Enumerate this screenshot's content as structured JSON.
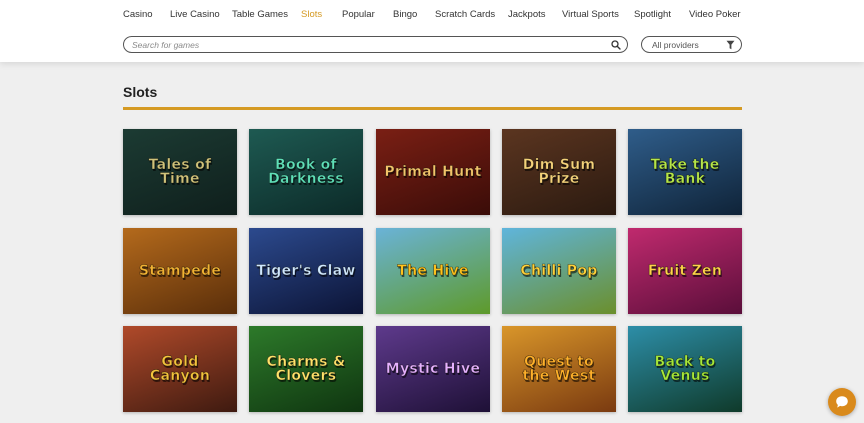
{
  "nav": {
    "items": [
      {
        "label": "Casino"
      },
      {
        "label": "Live Casino"
      },
      {
        "label": "Table Games"
      },
      {
        "label": "Slots",
        "active": true
      },
      {
        "label": "Popular"
      },
      {
        "label": "Bingo"
      },
      {
        "label": "Scratch Cards"
      },
      {
        "label": "Jackpots"
      },
      {
        "label": "Virtual Sports"
      },
      {
        "label": "Spotlight"
      },
      {
        "label": "Video Poker"
      }
    ],
    "accent_color": "#d59a23"
  },
  "search": {
    "placeholder": "Search for games",
    "value": "",
    "icon": "search-icon"
  },
  "providers_filter": {
    "label": "All providers",
    "icon": "funnel-icon"
  },
  "section": {
    "title": "Slots"
  },
  "games": [
    {
      "title": "Tales of Time",
      "label_color": "#cfc27a",
      "bg": [
        "#1c3b33",
        "#0f1f1c"
      ]
    },
    {
      "title": "Book of Darkness",
      "label_color": "#5fe0b8",
      "bg": [
        "#1e5a52",
        "#0c2a28"
      ]
    },
    {
      "title": "Primal Hunt",
      "label_color": "#f3c46a",
      "bg": [
        "#7a1f14",
        "#3a0c08"
      ]
    },
    {
      "title": "Dim Sum Prize",
      "label_color": "#f5d27a",
      "bg": [
        "#5b3520",
        "#2b1a10"
      ]
    },
    {
      "title": "Take the Bank",
      "label_color": "#b6e64a",
      "bg": [
        "#2f5d8a",
        "#0f2338"
      ]
    },
    {
      "title": "Stampede",
      "label_color": "#f2b233",
      "bg": [
        "#b46a1c",
        "#5a2e0a"
      ]
    },
    {
      "title": "Tiger's Claw",
      "label_color": "#cfe8ff",
      "bg": [
        "#2c4a8e",
        "#0c1436"
      ]
    },
    {
      "title": "The Hive",
      "label_color": "#ffc21c",
      "bg": [
        "#6ab3d8",
        "#5e9a2a"
      ]
    },
    {
      "title": "Chilli Pop",
      "label_color": "#ffd23a",
      "bg": [
        "#5fb5dc",
        "#6b8f2c"
      ]
    },
    {
      "title": "Fruit Zen",
      "label_color": "#ffd24a",
      "bg": [
        "#c02a6e",
        "#5a0e3a"
      ]
    },
    {
      "title": "Gold Canyon",
      "label_color": "#f4c23c",
      "bg": [
        "#b04a2a",
        "#3e1a10"
      ]
    },
    {
      "title": "Charms & Clovers",
      "label_color": "#ffe36a",
      "bg": [
        "#2d7a2a",
        "#0f3510"
      ]
    },
    {
      "title": "Mystic Hive",
      "label_color": "#e6b1ff",
      "bg": [
        "#5e3a8c",
        "#1e1036"
      ]
    },
    {
      "title": "Quest to the West",
      "label_color": "#ffb02a",
      "bg": [
        "#d9962a",
        "#7a3a10"
      ]
    },
    {
      "title": "Back to Venus",
      "label_color": "#a6e83a",
      "bg": [
        "#2d8ea8",
        "#0f3a2a"
      ]
    }
  ],
  "chat": {
    "icon": "chat-bubble-icon",
    "color": "#d98a1c"
  }
}
